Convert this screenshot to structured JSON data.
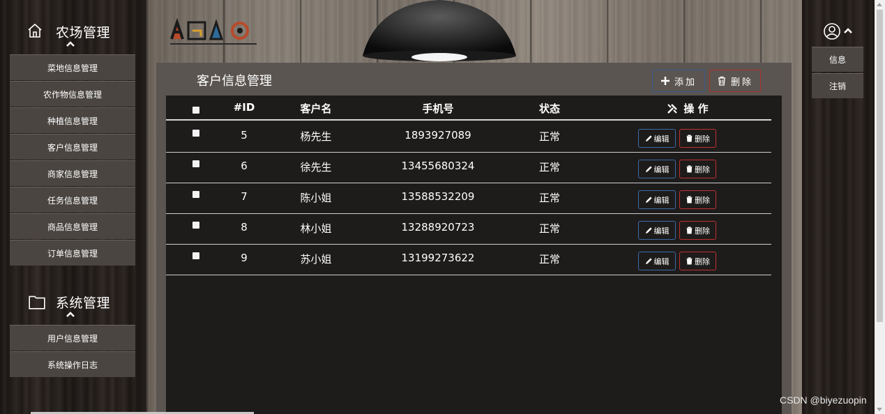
{
  "sidebar": {
    "farm": {
      "title": "农场管理",
      "items": [
        "菜地信息管理",
        "农作物信息管理",
        "种植信息管理",
        "客户信息管理",
        "商家信息管理",
        "任务信息管理",
        "商品信息管理",
        "订单信息管理"
      ]
    },
    "system": {
      "title": "系统管理",
      "items": [
        "用户信息管理",
        "系统操作日志"
      ]
    }
  },
  "user_menu": {
    "info": "信息",
    "logout": "注销"
  },
  "panel": {
    "title": "客户信息管理",
    "add_label": "添加",
    "delete_label": "删除"
  },
  "table": {
    "headers": {
      "id": "#ID",
      "name": "客户名",
      "phone": "手机号",
      "status": "状态",
      "op": "操 作"
    },
    "rows": [
      {
        "id": "5",
        "name": "杨先生",
        "phone": "1893927089",
        "status": "正常"
      },
      {
        "id": "6",
        "name": "徐先生",
        "phone": "13455680324",
        "status": "正常"
      },
      {
        "id": "7",
        "name": "陈小姐",
        "phone": "13588532209",
        "status": "正常"
      },
      {
        "id": "8",
        "name": "林小姐",
        "phone": "13288920723",
        "status": "正常"
      },
      {
        "id": "9",
        "name": "苏小姐",
        "phone": "13199273622",
        "status": "正常"
      }
    ],
    "edit_label": "编辑",
    "delete_label": "删除"
  },
  "watermark": "CSDN @biyezuopin",
  "icons": {
    "home": "home-icon",
    "folder": "folder-icon",
    "user": "user-circle-icon",
    "tools": "tools-icon",
    "plus": "plus-icon",
    "trash": "trash-icon",
    "pencil": "pencil-icon"
  }
}
